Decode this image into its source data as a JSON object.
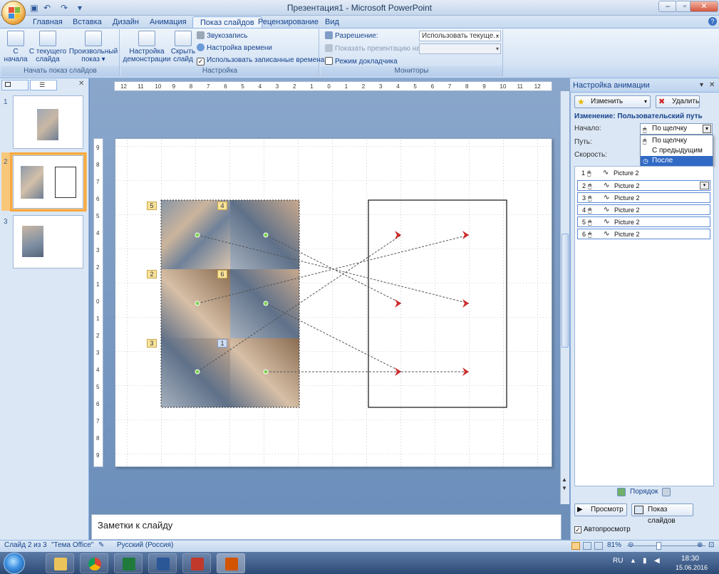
{
  "window": {
    "title": "Презентация1 - Microsoft PowerPoint"
  },
  "tabs": [
    "Главная",
    "Вставка",
    "Дизайн",
    "Анимация",
    "Показ слайдов",
    "Рецензирование",
    "Вид"
  ],
  "active_tab": "Показ слайдов",
  "ribbon": {
    "groups": {
      "start_show": "Начать показ слайдов",
      "setup": "Настройка",
      "monitors": "Мониторы"
    },
    "from_beginning": [
      "С",
      "начала"
    ],
    "from_current": [
      "С текущего",
      "слайда"
    ],
    "custom_show": [
      "Произвольный",
      "показ ▾"
    ],
    "setup_show": [
      "Настройка",
      "демонстрации"
    ],
    "hide_slide": [
      "Скрыть",
      "слайд"
    ],
    "record_narration": "Звукозапись",
    "rehearse_timings": "Настройка времени",
    "use_timings": "Использовать записанные времена",
    "resolution_label": "Разрешение:",
    "resolution_value": "Использовать текуще...",
    "show_on_label": "Показать презентацию на:",
    "presenter_view": "Режим докладчика"
  },
  "slides_panel": {
    "slides": [
      {
        "number": "1"
      },
      {
        "number": "2"
      },
      {
        "number": "3"
      }
    ],
    "selected": 2
  },
  "slide": {
    "labels": [
      "5",
      "4",
      "2",
      "6",
      "3",
      "1"
    ]
  },
  "notes": {
    "placeholder": "Заметки к слайду"
  },
  "animation_pane": {
    "title": "Настройка анимации",
    "change_button": "Изменить",
    "remove_button": "Удалить",
    "change_header": "Изменение: Пользовательский путь",
    "start_label": "Начало:",
    "path_label": "Путь:",
    "speed_label": "Скорость:",
    "start_value": "По щелчку",
    "start_options": [
      "По щелчку",
      "С предыдущим",
      "После предыдущего"
    ],
    "items": [
      {
        "number": "1",
        "name": "Picture 2"
      },
      {
        "number": "2",
        "name": "Picture 2"
      },
      {
        "number": "3",
        "name": "Picture 2"
      },
      {
        "number": "4",
        "name": "Picture 2"
      },
      {
        "number": "5",
        "name": "Picture 2"
      },
      {
        "number": "6",
        "name": "Picture 2"
      }
    ],
    "order_label": "Порядок",
    "preview_button": "Просмотр",
    "slideshow_button": "Показ слайдов",
    "autopreview_label": "Автопросмотр"
  },
  "status": {
    "slide_info": "Слайд 2 из 3",
    "theme": "\"Тема Office\"",
    "language": "Русский (Россия)",
    "zoom": "81%"
  },
  "taskbar": {
    "lang": "RU",
    "time": "18:30",
    "date": "15.06.2016"
  },
  "colors": {
    "accent": "#15428b",
    "selection": "#f7a940",
    "motion_arrow": "#cc2b2b"
  }
}
